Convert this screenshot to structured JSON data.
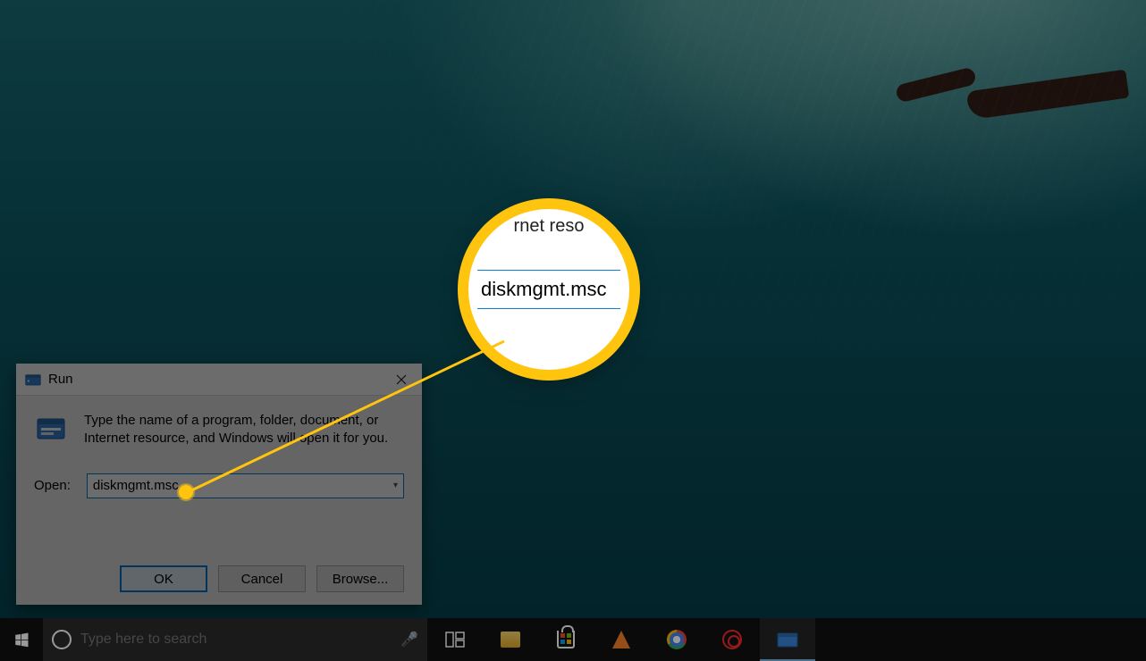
{
  "run_dialog": {
    "title": "Run",
    "description": "Type the name of a program, folder, document, or Internet resource, and Windows will open it for you.",
    "open_label": "Open:",
    "open_value": "diskmgmt.msc",
    "buttons": {
      "ok": "OK",
      "cancel": "Cancel",
      "browse": "Browse..."
    }
  },
  "magnifier": {
    "partial_text": "rnet reso",
    "value": "diskmgmt.msc"
  },
  "taskbar": {
    "search_placeholder": "Type here to search",
    "icons": {
      "start": "start-icon",
      "cortana": "cortana-icon",
      "mic": "mic-icon",
      "taskview": "taskview-icon",
      "explorer": "file-explorer-icon",
      "store": "microsoft-store-icon",
      "vlc": "vlc-icon",
      "chrome": "chrome-icon",
      "red": "app-icon",
      "run": "run-dialog-icon"
    }
  },
  "colors": {
    "accent": "#0a7dd6",
    "highlight": "#ffc40d"
  }
}
